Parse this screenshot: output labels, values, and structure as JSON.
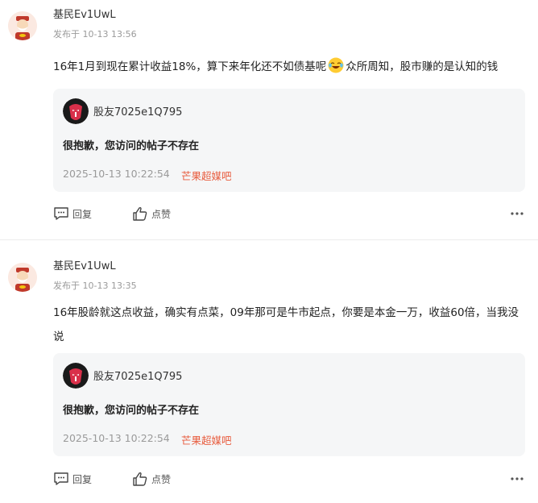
{
  "posts": [
    {
      "author": "基民Ev1UwL",
      "meta": "发布于 10-13 13:56",
      "content_before_emoji": "16年1月到现在累计收益18%，算下来年化还不如债基呢",
      "content_after_emoji": "众所周知，股市赚的是认知的钱",
      "emoji": "laughing-tears-emoji",
      "quote": {
        "user": "股友7025e1Q795",
        "text": "很抱歉，您访问的帖子不存在",
        "time": "2025-10-13 10:22:54",
        "source": "芒果超媒吧"
      },
      "actions": {
        "reply": "回复",
        "like": "点赞"
      }
    },
    {
      "author": "基民Ev1UwL",
      "meta": "发布于 10-13 13:35",
      "content": "16年股龄就这点收益，确实有点菜，09年那可是牛市起点，你要是本金一万，收益60倍，当我没说",
      "quote": {
        "user": "股友7025e1Q795",
        "text": "很抱歉，您访问的帖子不存在",
        "time": "2025-10-13 10:22:54",
        "source": "芒果超媒吧"
      },
      "actions": {
        "reply": "回复",
        "like": "点赞"
      }
    }
  ],
  "colors": {
    "source_link": "#e85b3d",
    "quote_bg": "#f5f6f7",
    "meta": "#9a9a9a"
  }
}
